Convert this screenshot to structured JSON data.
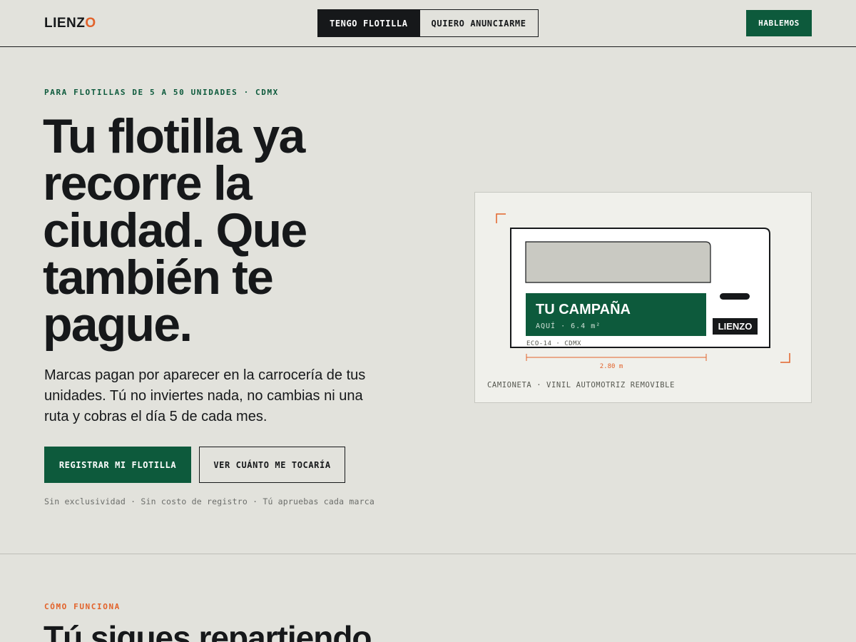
{
  "header": {
    "logo_prefix": "LIENZ",
    "logo_accent": "O",
    "tabs": [
      {
        "label": "TENGO FLOTILLA",
        "active": true
      },
      {
        "label": "QUIERO ANUNCIARME",
        "active": false
      }
    ],
    "cta_label": "HABLEMOS"
  },
  "hero": {
    "eyebrow": "PARA FLOTILLAS DE 5 A 50 UNIDADES · CDMX",
    "headline": "Tu flotilla ya recorre la ciudad. Que también te pague.",
    "lede": "Marcas pagan por aparecer en la carrocería de tus unidades. Tú no inviertes nada, no cambias ni una ruta y cobras el día 5 de cada mes.",
    "primary_cta": "REGISTRAR MI FLOTILLA",
    "secondary_cta": "VER CUÁNTO ME TOCARÍA",
    "fineprint": "Sin exclusividad · Sin costo de registro · Tú apruebas cada marca"
  },
  "illustration": {
    "campaign_title": "TU CAMPAÑA",
    "campaign_sub": "AQUÍ · 6.4 m²",
    "badge": "LIENZO",
    "unit_id": "ECO-14 · CDMX",
    "dimension": "2.80 m",
    "caption": "CAMIONETA · VINIL AUTOMOTRIZ REMOVIBLE"
  },
  "how": {
    "eyebrow": "CÓMO FUNCIONA",
    "title": "Tú sigues repartiendo."
  },
  "colors": {
    "background": "#e2e2dc",
    "ink": "#16181a",
    "green": "#0d5a3c",
    "orange": "#e2622a",
    "card": "#f0f0eb"
  }
}
